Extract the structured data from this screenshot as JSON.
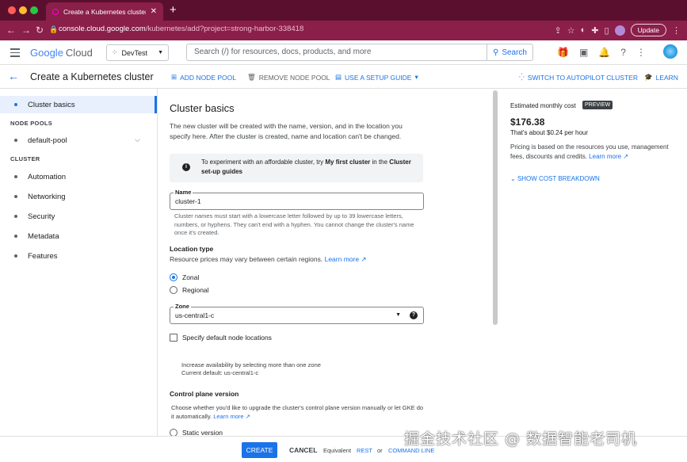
{
  "browser": {
    "tab_title": "Create a Kubernetes cluster –",
    "url_host": "console.cloud.google.com",
    "url_path": "/kubernetes/add?project=strong-harbor-338418",
    "update_label": "Update"
  },
  "header": {
    "logo_google": "Google",
    "logo_cloud": "Cloud",
    "project": "DevTest",
    "search_placeholder": "Search (/) for resources, docs, products, and more",
    "search_button": "Search"
  },
  "actionbar": {
    "title": "Create a Kubernetes cluster",
    "add_node_pool": "ADD NODE POOL",
    "remove_node_pool": "REMOVE NODE POOL",
    "setup_guide": "USE A SETUP GUIDE",
    "autopilot": "SWITCH TO AUTOPILOT CLUSTER",
    "learn": "LEARN"
  },
  "sidebar": {
    "active": "Cluster basics",
    "node_pools_heading": "NODE POOLS",
    "node_pool": "default-pool",
    "cluster_heading": "CLUSTER",
    "items": [
      "Automation",
      "Networking",
      "Security",
      "Metadata",
      "Features"
    ]
  },
  "main": {
    "heading": "Cluster basics",
    "intro": "The new cluster will be created with the name, version, and in the location you specify here. After the cluster is created, name and location can't be changed.",
    "info_prefix": "To experiment with an affordable cluster, try ",
    "info_bold1": "My first cluster",
    "info_mid": " in the ",
    "info_bold2": "Cluster set-up guides",
    "name_label": "Name",
    "name_value": "cluster-1",
    "name_helper": "Cluster names must start with a lowercase letter followed by up to 39 lowercase letters, numbers, or hyphens. They can't end with a hyphen. You cannot change the cluster's name once it's created.",
    "location_heading": "Location type",
    "location_desc": "Resource prices may vary between certain regions. ",
    "learn_more": "Learn more",
    "zonal": "Zonal",
    "regional": "Regional",
    "zone_label": "Zone",
    "zone_value": "us-central1-c",
    "default_locations": "Specify default node locations",
    "availability_1": "Increase availability by selecting more than one zone",
    "availability_2": "Current default: us-central1-c",
    "control_plane_heading": "Control plane version",
    "control_plane_desc": "Choose whether you'd like to upgrade the cluster's control plane version manually or let GKE do it automatically. ",
    "static_version": "Static version"
  },
  "cost": {
    "estimated": "Estimated monthly cost",
    "preview": "PREVIEW",
    "price": "$176.38",
    "hourly": "That's about $0.24 per hour",
    "pricing_note": "Pricing is based on the resources you use, management fees, discounts and credits. ",
    "learn_more": "Learn more",
    "breakdown": "SHOW COST BREAKDOWN"
  },
  "footer": {
    "create": "CREATE",
    "cancel": "CANCEL",
    "equivalent": "Equivalent",
    "rest": "REST",
    "or": "or",
    "command_line": "COMMAND LINE"
  },
  "watermark": "掘金技术社区 @ 数据智能老司机",
  "colors": {
    "accent": "#1a73e8",
    "browser_chrome": "#8a1f4a"
  }
}
